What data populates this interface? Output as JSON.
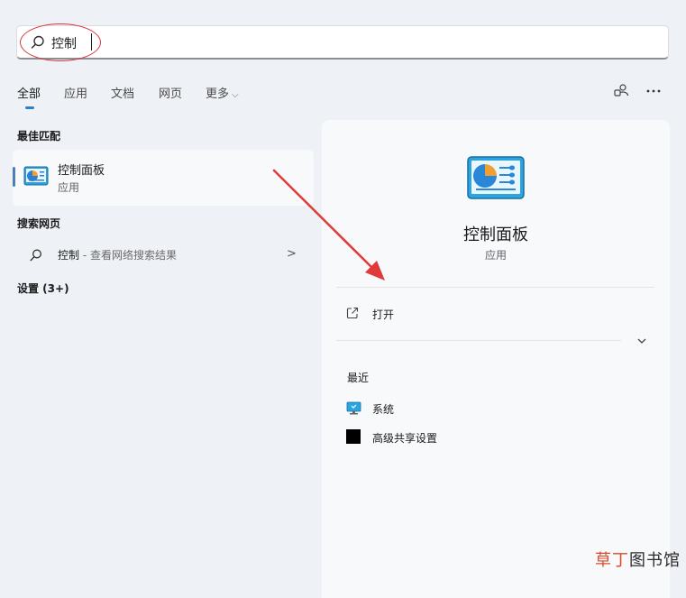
{
  "search": {
    "query": "控制"
  },
  "tabs": [
    {
      "label": "全部",
      "active": true
    },
    {
      "label": "应用"
    },
    {
      "label": "文档"
    },
    {
      "label": "网页"
    },
    {
      "label": "更多"
    }
  ],
  "top_icons": [
    "share-person-icon",
    "more-ellipsis-icon"
  ],
  "left": {
    "best_match_title": "最佳匹配",
    "best_match": {
      "title": "控制面板",
      "subtitle": "应用",
      "icon": "control-panel-icon"
    },
    "web_title": "搜索网页",
    "web_result": {
      "query": "控制",
      "suffix": " - 查看网络搜索结果",
      "icon": "search-icon"
    },
    "settings_title": "设置 (3+)"
  },
  "right": {
    "app_title": "控制面板",
    "app_subtitle": "应用",
    "actions": [
      {
        "label": "打开",
        "icon": "open-external-icon"
      }
    ],
    "recent_title": "最近",
    "recent_items": [
      {
        "label": "系统",
        "icon": "system-monitor-icon"
      },
      {
        "label": "高级共享设置",
        "icon": "black-square-icon"
      }
    ]
  },
  "watermark": {
    "part1": "草丁",
    "part2": "图书馆"
  },
  "colors": {
    "accent": "#2f7fd1",
    "annotation": "#d9363e",
    "background": "#eef1f5"
  }
}
